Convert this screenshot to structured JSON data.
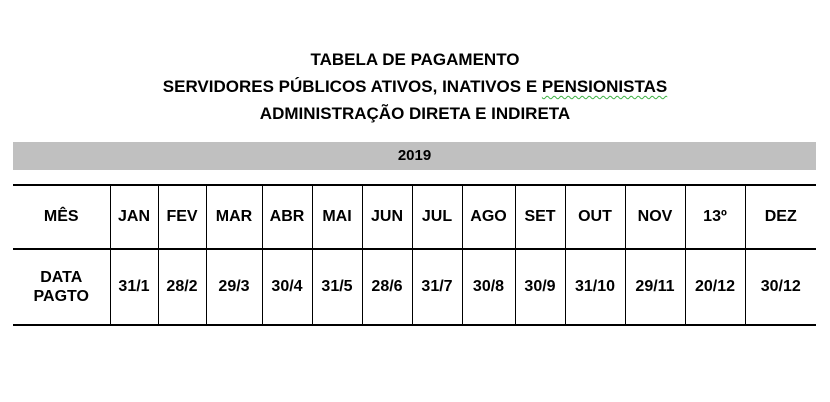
{
  "titles": {
    "line1": "TABELA DE PAGAMENTO",
    "line2_prefix": "SERVIDORES PÚBLICOS ATIVOS, INATIVOS E ",
    "line2_wavy": "PENSIONISTAS",
    "line3": "ADMINISTRAÇÃO  DIRETA E INDIRETA"
  },
  "year": "2019",
  "table": {
    "row_month_label": "MÊS",
    "row_date_label_1": "DATA",
    "row_date_label_2": "PAGTO",
    "months": [
      "JAN",
      "FEV",
      "MAR",
      "ABR",
      "MAI",
      "JUN",
      "JUL",
      "AGO",
      "SET",
      "OUT",
      "NOV",
      "13º",
      "DEZ"
    ],
    "dates": [
      "31/1",
      "28/2",
      "29/3",
      "30/4",
      "31/5",
      "28/6",
      "31/7",
      "30/8",
      "30/9",
      "31/10",
      "29/11",
      "20/12",
      "30/12"
    ]
  }
}
